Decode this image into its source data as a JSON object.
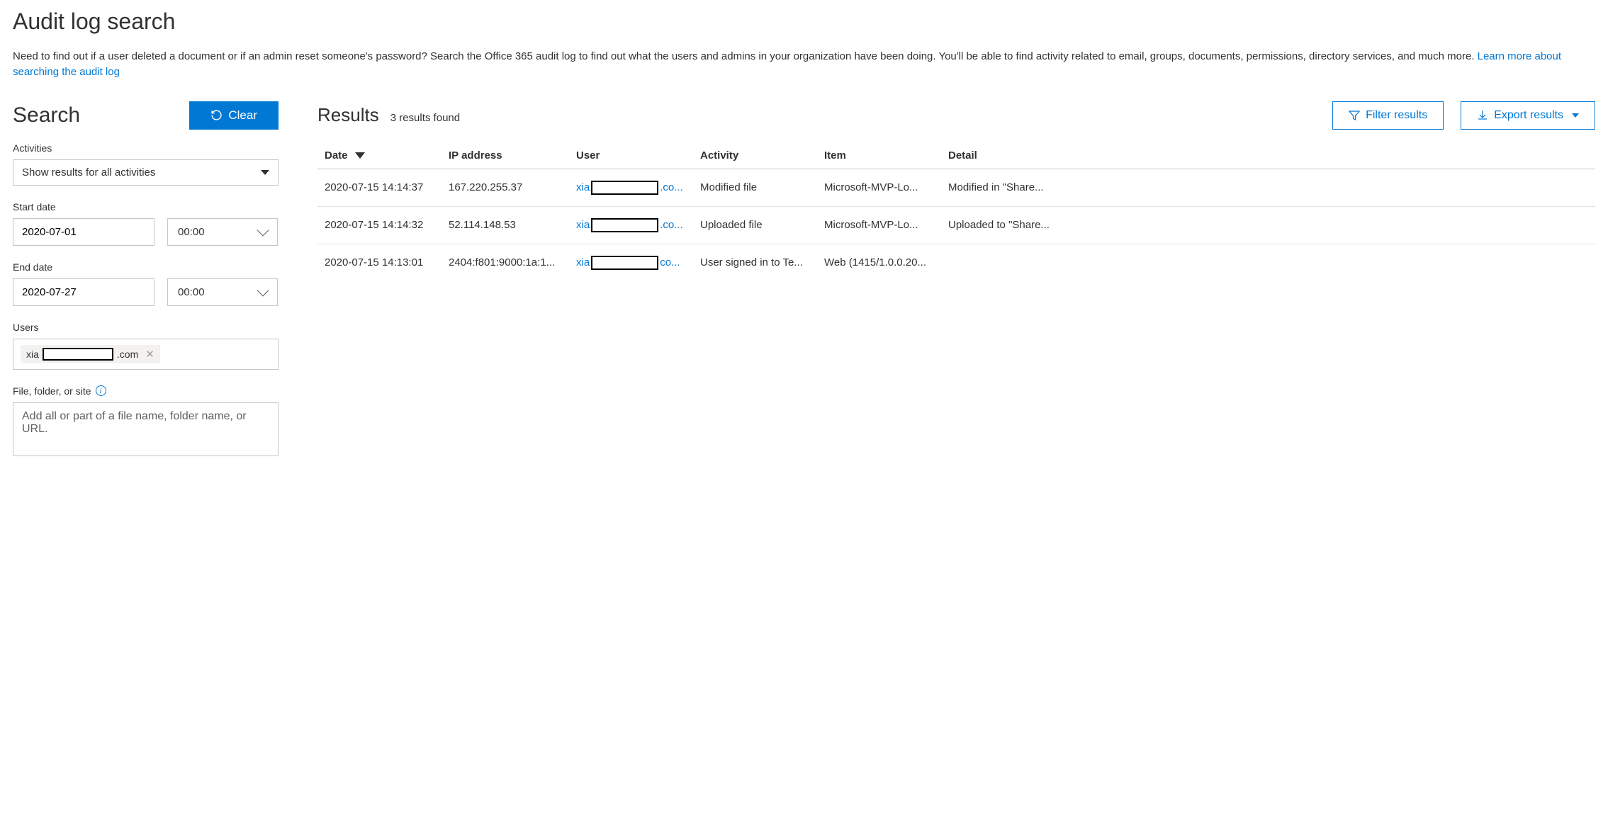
{
  "page": {
    "title": "Audit log search",
    "description_prefix": "Need to find out if a user deleted a document or if an admin reset someone's password? Search the Office 365 audit log to find out what the users and admins in your organization have been doing. You'll be able to find activity related to email, groups, documents, permissions, directory services, and much more. ",
    "learn_more": "Learn more about searching the audit log"
  },
  "search": {
    "heading": "Search",
    "clear_label": "Clear",
    "activities_label": "Activities",
    "activities_value": "Show results for all activities",
    "start_date_label": "Start date",
    "start_date_value": "2020-07-01",
    "start_time_value": "00:00",
    "end_date_label": "End date",
    "end_date_value": "2020-07-27",
    "end_time_value": "00:00",
    "users_label": "Users",
    "user_chip_prefix": "xia",
    "user_chip_suffix": ".com",
    "file_label": "File, folder, or site",
    "file_placeholder": "Add all or part of a file name, folder name, or URL."
  },
  "results": {
    "heading": "Results",
    "count_text": "3 results found",
    "filter_label": "Filter results",
    "export_label": "Export results",
    "columns": {
      "date": "Date",
      "ip": "IP address",
      "user": "User",
      "activity": "Activity",
      "item": "Item",
      "detail": "Detail"
    },
    "rows": [
      {
        "date": "2020-07-15 14:14:37",
        "ip": "167.220.255.37",
        "user_prefix": "xia",
        "user_suffix": ".co...",
        "activity": "Modified file",
        "item": "Microsoft-MVP-Lo...",
        "detail": "Modified in \"Share..."
      },
      {
        "date": "2020-07-15 14:14:32",
        "ip": "52.114.148.53",
        "user_prefix": "xia",
        "user_suffix": ".co...",
        "activity": "Uploaded file",
        "item": "Microsoft-MVP-Lo...",
        "detail": "Uploaded to \"Share..."
      },
      {
        "date": "2020-07-15 14:13:01",
        "ip": "2404:f801:9000:1a:1...",
        "user_prefix": "xia",
        "user_suffix": "co...",
        "activity": "User signed in to Te...",
        "item": "Web (1415/1.0.0.20...",
        "detail": ""
      }
    ]
  }
}
